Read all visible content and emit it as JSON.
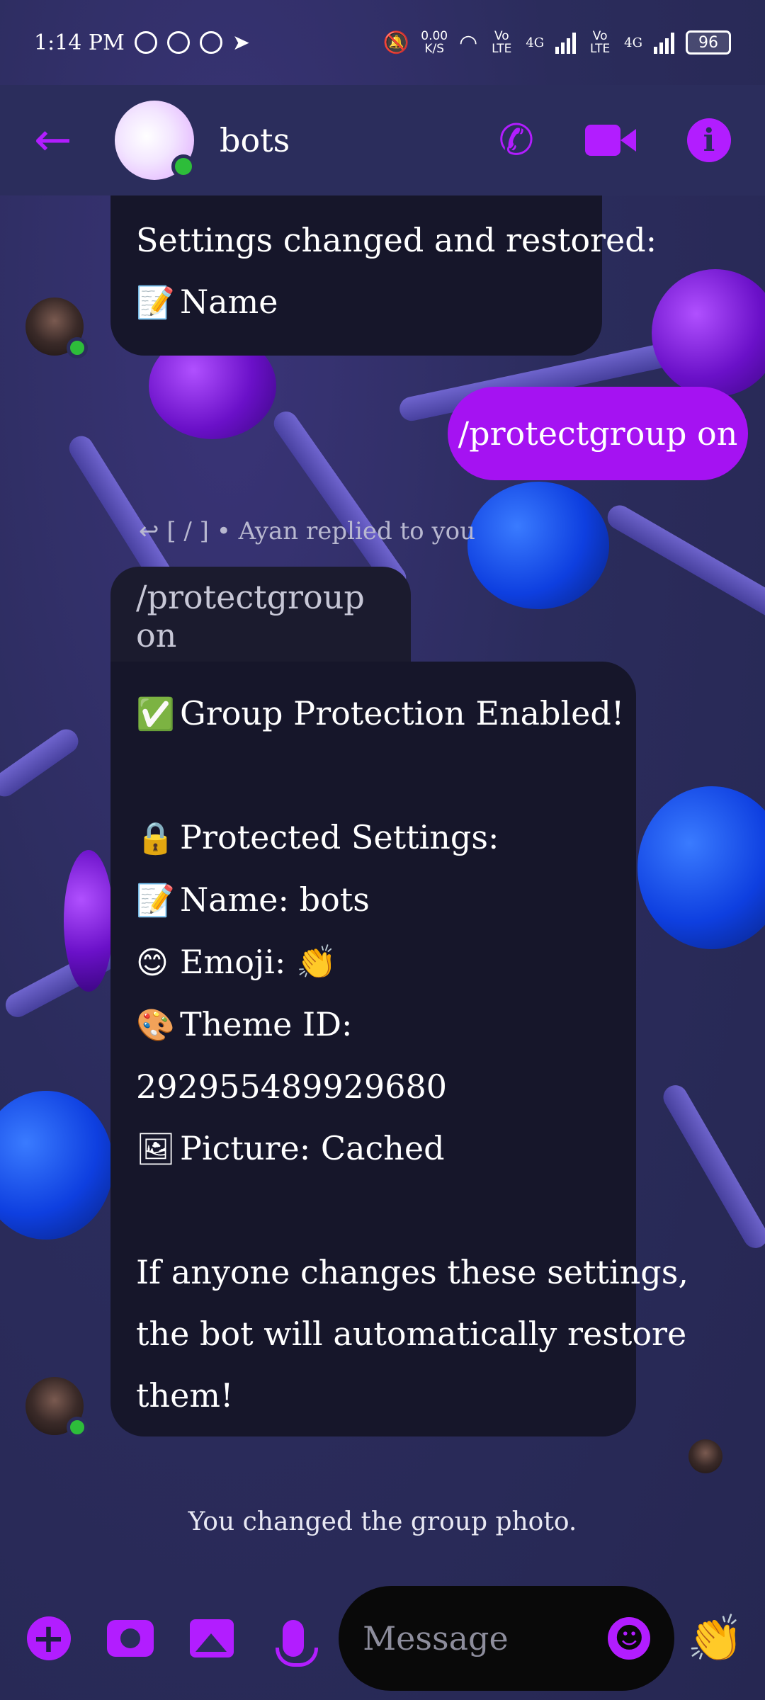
{
  "status_bar": {
    "time": "1:14 PM",
    "net_speed_value": "0.00",
    "net_speed_unit": "K/S",
    "sim1_label": "Vo LTE",
    "sim1_net": "4G",
    "sim2_label": "Vo LTE",
    "sim2_net": "4G",
    "battery": "96"
  },
  "header": {
    "title": "bots"
  },
  "messages": {
    "prev_bubble": {
      "line1": "Settings changed and restored:",
      "line2_emoji": "📝",
      "line2_text": "Name"
    },
    "sent": {
      "text": "/protectgroup on"
    },
    "reply_meta": "[ / ] • Ayan replied to you",
    "quoted": "/protectgroup on",
    "main_bubble": {
      "line1_emoji": "✅",
      "line1_text": "Group Protection Enabled!",
      "line2_emoji": "🔒",
      "line2_text": "Protected Settings:",
      "line3_emoji": "📝",
      "line3_text": "Name: bots",
      "line4_emoji": "😊",
      "line4_text": "Emoji: 👏",
      "line5_emoji": "🎨",
      "line5_text": "Theme ID:",
      "line6_text": "292955489929680",
      "line7_emoji": "🖼",
      "line7_text": "Picture: Cached",
      "line8_text": "If anyone changes these settings,",
      "line9_text": "the bot will automatically restore",
      "line10_text": "them!"
    },
    "system_note": "You changed the group photo."
  },
  "composer": {
    "placeholder": "Message",
    "like_emoji": "👏",
    "smile_glyph": "☻"
  },
  "colors": {
    "accent": "#b21dff",
    "sent_bubble": "#a512f2",
    "received_bubble": "#16162a",
    "header_bg": "#2b2d5c",
    "online": "#2dbd3a"
  }
}
